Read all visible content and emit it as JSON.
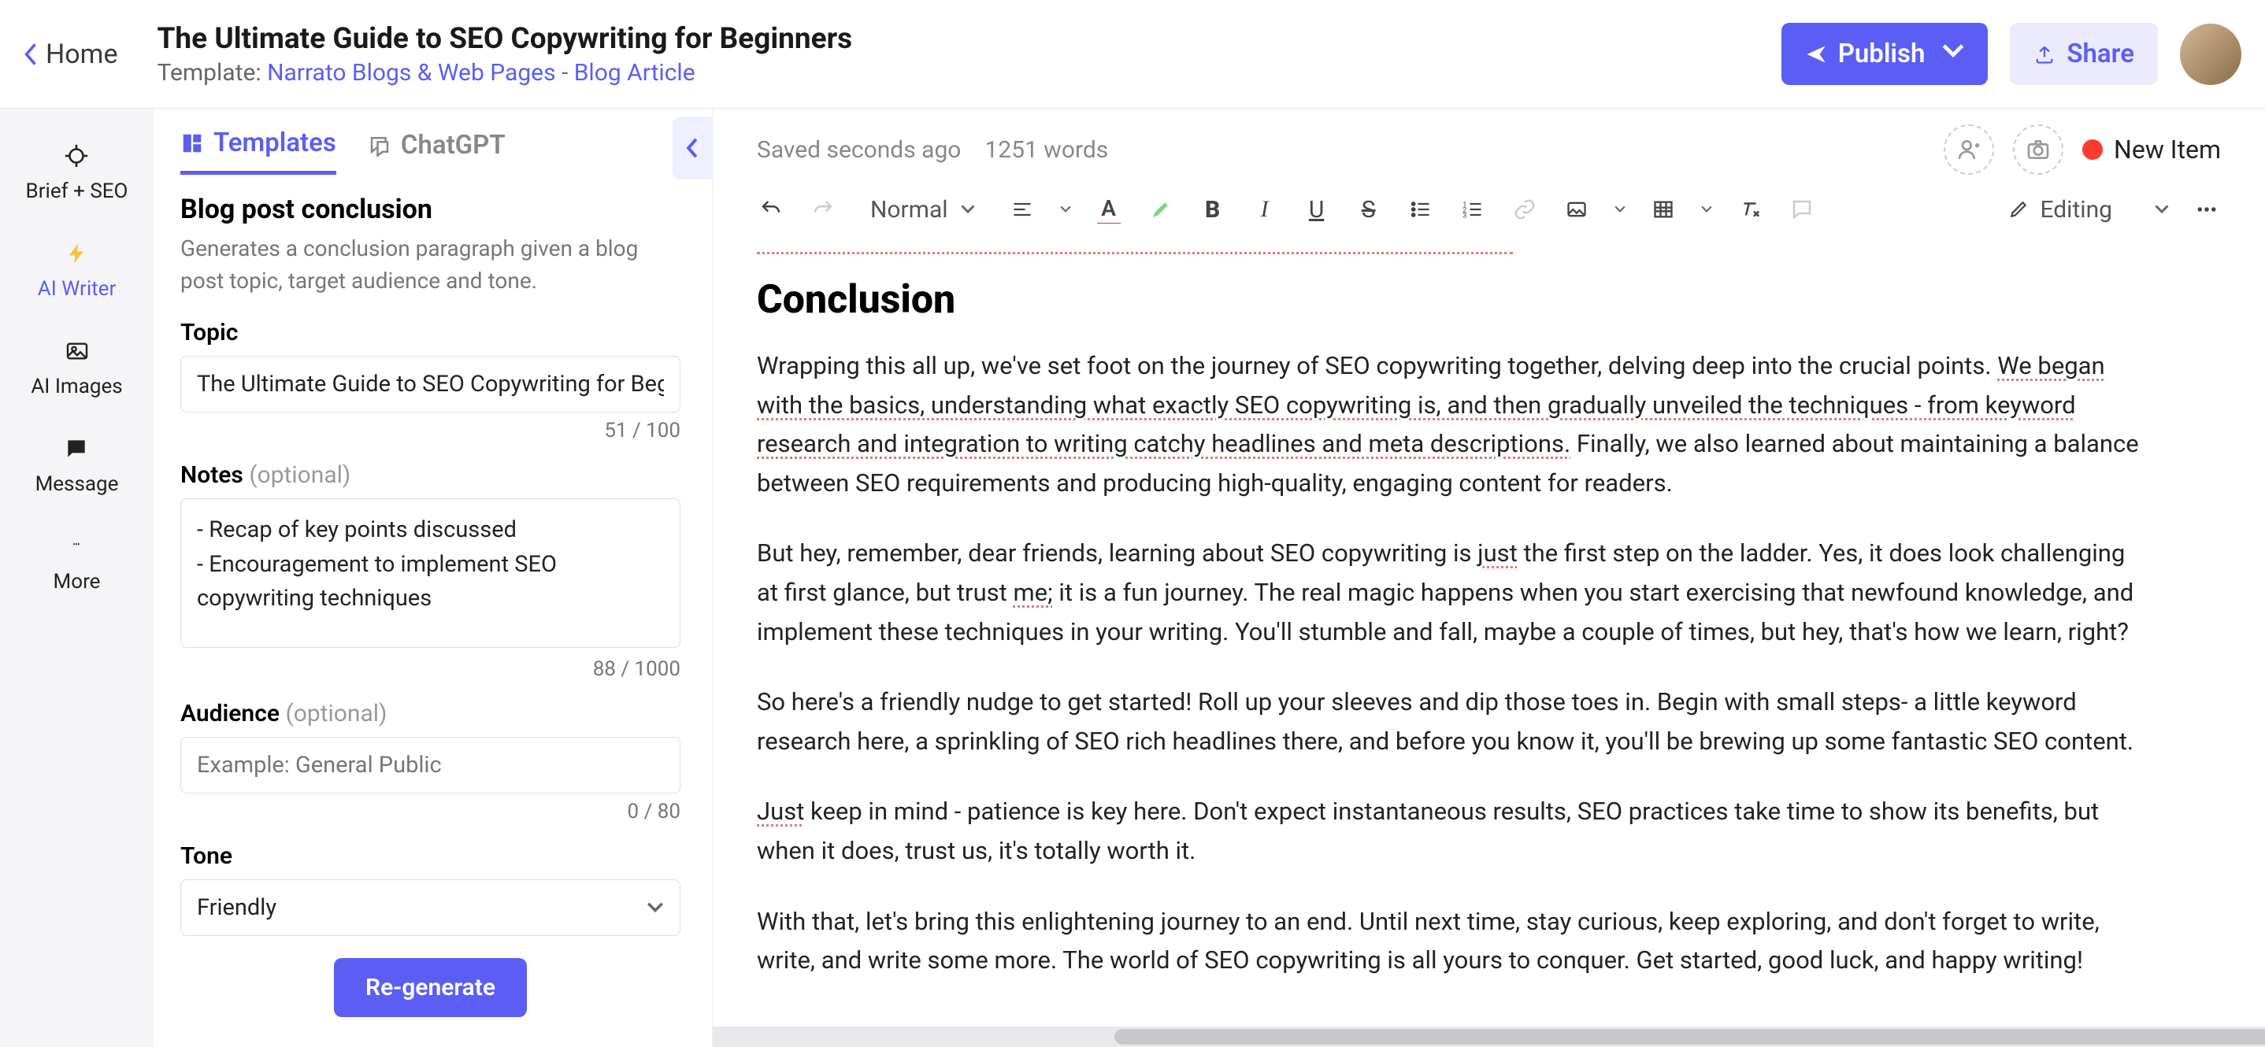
{
  "header": {
    "home_label": "Home",
    "title": "The Ultimate Guide to SEO Copywriting for Beginners",
    "template_prefix": "Template: ",
    "template_name": "Narrato Blogs & Web Pages - Blog Article",
    "publish_label": "Publish",
    "share_label": "Share"
  },
  "rail": {
    "items": [
      {
        "label": "Brief + SEO",
        "icon": "target"
      },
      {
        "label": "AI Writer",
        "icon": "bolt"
      },
      {
        "label": "AI Images",
        "icon": "image"
      },
      {
        "label": "Message",
        "icon": "chat"
      },
      {
        "label": "More",
        "icon": "dots"
      }
    ]
  },
  "panel": {
    "tabs": {
      "templates": "Templates",
      "chatgpt": "ChatGPT"
    },
    "title": "Blog post conclusion",
    "description": "Generates a conclusion paragraph given a blog post topic, target audience and tone.",
    "topic": {
      "label": "Topic",
      "value": "The Ultimate Guide to SEO Copywriting for Beginners",
      "counter": "51 / 100"
    },
    "notes": {
      "label": "Notes ",
      "optional": "(optional)",
      "value": "- Recap of key points discussed\n- Encouragement to implement SEO copywriting techniques",
      "counter": "88 / 1000"
    },
    "audience": {
      "label": "Audience ",
      "optional": "(optional)",
      "placeholder": "Example: General Public",
      "counter": "0 / 80"
    },
    "tone": {
      "label": "Tone",
      "value": "Friendly"
    },
    "regenerate": "Re-generate"
  },
  "editor": {
    "saved": "Saved seconds ago",
    "words": "1251 words",
    "status": "New Item",
    "format": "Normal",
    "mode": "Editing",
    "heading": "Conclusion",
    "p1a": "Wrapping this all up, we've set foot on the journey of SEO copywriting together, delving deep into the crucial points. ",
    "p1b": "We began with the basics, understanding what exactly SEO copywriting is, and then gradually unveiled the techniques - from keyword research and integration to writing catchy headlines and meta descriptions.",
    "p1c": " Finally, we also learned about maintaining a balance between SEO requirements and producing high-quality, engaging content for readers.",
    "p2a": "But hey, remember, dear friends, learning about SEO copywriting is ",
    "p2_just": "just",
    "p2b": " the first step on the ladder. Yes, it does look challenging at first glance, but trust ",
    "p2_me": "me;",
    "p2c": " it is a fun journey. The real magic happens when you start exercising that newfound knowledge, and implement these techniques in your writing. You'll stumble and fall, maybe a couple of times, but hey, that's how we learn, right?",
    "p3": "So here's a friendly nudge to get started! Roll up your sleeves and dip those toes in. Begin with small steps- a little keyword research here, a sprinkling of SEO rich headlines there, and before you know it, you'll be brewing up some fantastic SEO content.",
    "p4_just": "Just",
    "p4": " keep in mind - patience is key here. Don't expect instantaneous results, SEO practices take time to show its benefits, but when it does, trust us, it's totally worth it.",
    "p5": "With that, let's bring this enlightening journey to an end. Until next time, stay curious, keep exploring, and don't forget to write, write, and write some more. The world of SEO copywriting is all yours to conquer. Get started, good luck, and happy writing!"
  }
}
